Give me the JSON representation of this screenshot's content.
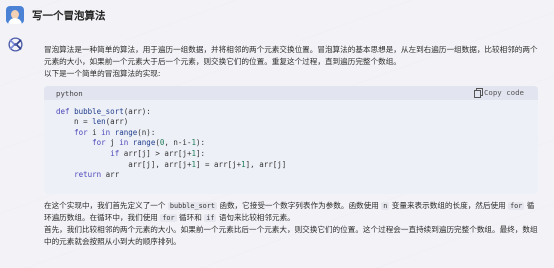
{
  "user_message": "写一个冒泡算法",
  "intro": {
    "line1": "冒泡算法是一种简单的算法，用于遍历一组数据，并将相邻的两个元素交换位置。冒泡算法的基本思想是，从左到右遍历一组数据，比较相邻的两个",
    "line2": "元素的大小，如果前一个元素大于后一个元素，则交换它们的位置。重复这个过程，直到遍历完整个数组。",
    "line3": "以下是一个简单的冒泡算法的实现:"
  },
  "code": {
    "language": "python",
    "copy_label": "Copy code",
    "copy_icon": "copy-icon",
    "lines": [
      "def bubble_sort(arr):",
      "    n = len(arr)",
      "    for i in range(n):",
      "        for j in range(0, n-i-1):",
      "            if arr[j] > arr[j+1]:",
      "                arr[j], arr[j+1] = arr[j+1], arr[j]",
      "    return arr"
    ]
  },
  "explanation": {
    "p1_a": "在这个实现中，我们首先定义了一个",
    "p1_code1": "bubble_sort",
    "p1_b": "函数，它接受一个数字列表作为参数。函数使用",
    "p1_code2": "n",
    "p1_c": "变量来表示数组的长度，然后使用",
    "p1_code3": "for",
    "p1_d": "循",
    "p2_a": "环遍历数组。在循环中，我们使用",
    "p2_code1": "for",
    "p2_b": "循环和",
    "p2_code2": "if",
    "p2_c": "语句来比较相邻元素。",
    "p3": "首先，我们比较相邻的两个元素的大小。如果前一个元素比后一个元素大，则交换它们的位置。这个过程会一直持续到遍历完整个数组。最终，数组",
    "p4": "中的元素就会按照从小到大的顺序排列。"
  },
  "colors": {
    "keyword": "#4b47b8",
    "function": "#23408e",
    "number": "#1c7c54",
    "background": "#f3f3f7",
    "code_background": "#eef0f8"
  }
}
